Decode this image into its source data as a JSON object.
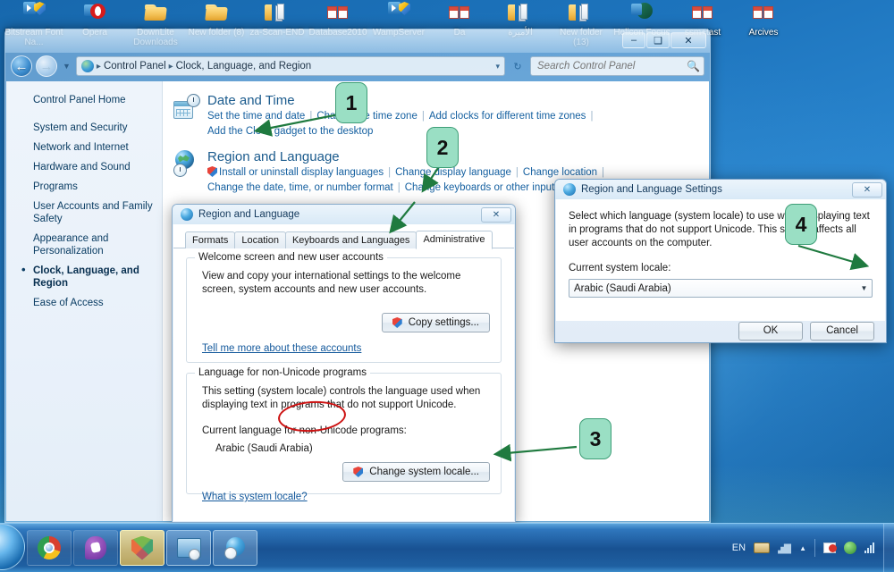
{
  "desktop": {
    "icons": [
      {
        "label": "Bitstream Font Na...",
        "icon": "shortcut-shield-icon"
      },
      {
        "label": "Opera",
        "icon": "opera-shortcut-icon"
      },
      {
        "label": "DownLite Downloads",
        "icon": "folder-icon"
      },
      {
        "label": "New folder (8)",
        "icon": "folder-icon"
      },
      {
        "label": "za-Scan-END",
        "icon": "folder-pages-icon"
      },
      {
        "label": "Database2010",
        "icon": "documents-icon"
      },
      {
        "label": "WampServer",
        "icon": "shortcut-shield-icon"
      },
      {
        "label": "Da",
        "icon": "documents-icon"
      },
      {
        "label": "الأميرة",
        "icon": "folder-pages-icon"
      },
      {
        "label": "New folder (13)",
        "icon": "folder-pages-icon"
      },
      {
        "label": "Helicon Focus",
        "icon": "helicon-shortcut-icon"
      },
      {
        "label": "ssm+tast",
        "icon": "documents-icon"
      },
      {
        "label": "Arcives",
        "icon": "documents-icon"
      }
    ]
  },
  "control_panel": {
    "window_buttons": {
      "minimize": "–",
      "maximize": "❑",
      "close": "✕"
    },
    "breadcrumb": {
      "separator": "▸",
      "items": [
        "Control Panel",
        "Clock, Language, and Region"
      ],
      "dropdown": "▾"
    },
    "refresh_label": "↻",
    "search": {
      "placeholder": "Search Control Panel",
      "value": "",
      "icon": "search-icon"
    },
    "sidebar": {
      "home": "Control Panel Home",
      "items": [
        {
          "label": "System and Security",
          "active": false
        },
        {
          "label": "Network and Internet",
          "active": false
        },
        {
          "label": "Hardware and Sound",
          "active": false
        },
        {
          "label": "Programs",
          "active": false
        },
        {
          "label": "User Accounts and Family Safety",
          "active": false
        },
        {
          "label": "Appearance and Personalization",
          "active": false
        },
        {
          "label": "Clock, Language, and Region",
          "active": true
        },
        {
          "label": "Ease of Access",
          "active": false
        }
      ]
    },
    "categories": [
      {
        "title": "Date and Time",
        "icon": "date-time-icon",
        "links_row1": [
          "Set the time and date",
          "Change the time zone",
          "Add clocks for different time zones"
        ],
        "links_row2": [
          "Add the Clock gadget to the desktop"
        ]
      },
      {
        "title": "Region and Language",
        "icon": "region-language-icon",
        "links_row1": [
          "Install or uninstall display languages",
          "Change display language",
          "Change location"
        ],
        "links_row2": [
          "Change the date, time, or number format",
          "Change keyboards or other input methods"
        ]
      }
    ]
  },
  "region_dialog": {
    "title": "Region and Language",
    "close_label": "✕",
    "tabs": [
      {
        "label": "Formats",
        "active": false
      },
      {
        "label": "Location",
        "active": false
      },
      {
        "label": "Keyboards and Languages",
        "active": false
      },
      {
        "label": "Administrative",
        "active": true
      }
    ],
    "group1": {
      "legend": "Welcome screen and new user accounts",
      "text": "View and copy your international settings to the welcome screen, system accounts and new user accounts.",
      "button": "Copy settings...",
      "link": "Tell me more about these accounts"
    },
    "group2": {
      "legend": "Language for non-Unicode programs",
      "text": "This setting (system locale) controls the language used when displaying text in programs that do not support Unicode.",
      "current_label": "Current language for non-Unicode programs:",
      "current_value": "Arabic (Saudi Arabia)",
      "button": "Change system locale...",
      "link": "What is system locale?"
    }
  },
  "settings_dialog": {
    "title": "Region and Language Settings",
    "close_label": "✕",
    "description": "Select which language (system locale) to use when displaying text in programs that do not support Unicode. This setting affects all user accounts on the computer.",
    "locale_label": "Current system locale:",
    "locale_value": "Arabic (Saudi Arabia)",
    "dropdown_arrow": "▼",
    "ok": "OK",
    "cancel": "Cancel"
  },
  "annotations": {
    "badge_color": "#9adfc4",
    "badge_border": "#3e9e77",
    "arrow_color": "#1f7a3f",
    "ink_color": "#cc1111",
    "badges": [
      {
        "number": "1",
        "points_to": "change-the-time-zone-link"
      },
      {
        "number": "2",
        "points_to": "change-keyboards-link"
      },
      {
        "number": "3",
        "points_to": "change-system-locale-button"
      },
      {
        "number": "4",
        "points_to": "current-system-locale-combo"
      }
    ]
  },
  "taskbar": {
    "start_label": "start-orb",
    "tasks": [
      {
        "name": "chrome",
        "state": "normal"
      },
      {
        "name": "viber",
        "state": "normal"
      },
      {
        "name": "shield",
        "state": "active"
      },
      {
        "name": "control-panel",
        "state": "open"
      },
      {
        "name": "region-globe",
        "state": "open"
      }
    ],
    "tray": {
      "language": "EN",
      "items": [
        "keyboard-icon",
        "network-icon",
        "show-hidden-icon",
        "flag-icon",
        "antivirus-icon",
        "signal-icon"
      ],
      "show_hidden": "▲"
    }
  }
}
